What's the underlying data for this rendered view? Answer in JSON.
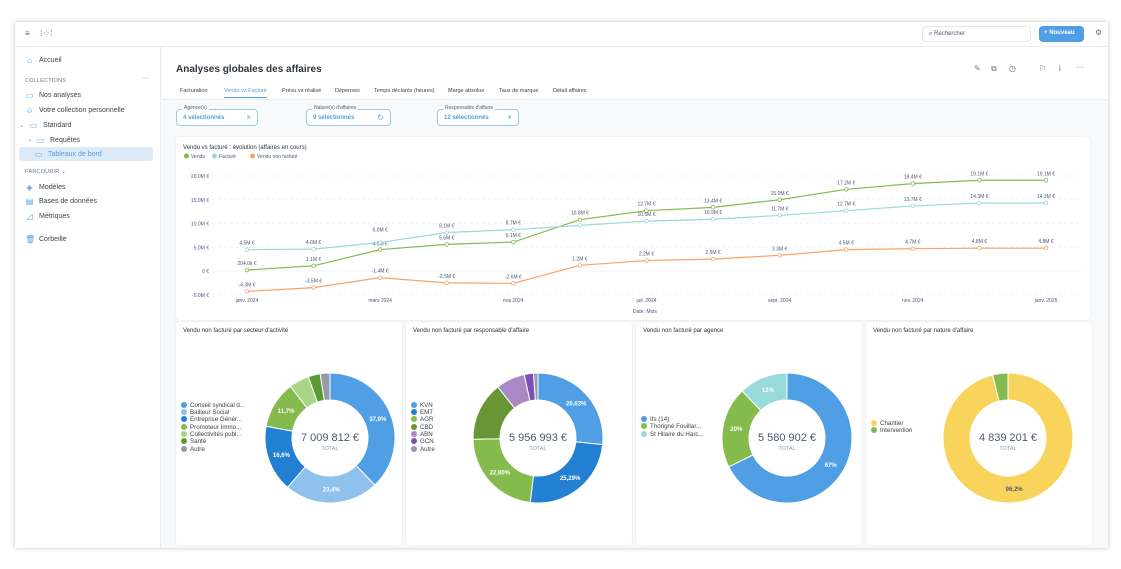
{
  "topbar": {
    "search_placeholder": "Rechercher",
    "new_button": "Nouveau"
  },
  "sidebar": {
    "home": "Accueil",
    "collections_header": "COLLECTIONS",
    "items": [
      "Nos analyses",
      "Votre collection personnelle",
      "Standard",
      "Requêtes",
      "Tableaux de bord"
    ],
    "browse_header": "PARCOURIR",
    "browse": [
      "Modèles",
      "Bases de données",
      "Métriques"
    ],
    "trash": "Corbeille"
  },
  "page": {
    "title": "Analyses globales des affaires"
  },
  "tabs": [
    {
      "label": "Facturation"
    },
    {
      "label": "Vendu vs Facturé",
      "active": true
    },
    {
      "label": "Prévu vs réalisé"
    },
    {
      "label": "Dépenses"
    },
    {
      "label": "Temps déclarés (heures)"
    },
    {
      "label": "Marge absolue"
    },
    {
      "label": "Taux de marque"
    },
    {
      "label": "Détail affaires"
    }
  ],
  "filters": [
    {
      "label": "Agence(s)",
      "value": "4 sélectionnés",
      "icon": "close-icon"
    },
    {
      "label": "Nature(s) d'affaires",
      "value": "9 sélectionnés",
      "icon": "reset-icon"
    },
    {
      "label": "Responsable d'affaire",
      "value": "12 sélectionnés",
      "icon": "close-icon"
    }
  ],
  "chart_data": [
    {
      "type": "line",
      "title": "Vendu vs facturé : évolution (affaires en cours)",
      "xlabel": "Date: Mois",
      "ylim": [
        -5,
        20
      ],
      "y_unit": "M €",
      "yticks": [
        "-5.0M €",
        "0 €",
        "5.0M €",
        "10.0M €",
        "15.0M €",
        "20.0M €"
      ],
      "x": [
        "janv. 2024",
        "févr. 2024",
        "mars 2024",
        "avr. 2024",
        "mai 2024",
        "juin 2024",
        "juil. 2024",
        "août 2024",
        "sept. 2024",
        "oct. 2024",
        "nov. 2024",
        "déc. 2024",
        "janv. 2025"
      ],
      "xtick_labels": [
        "janv. 2024",
        "",
        "mars 2024",
        "",
        "mai 2024",
        "",
        "juil. 2024",
        "",
        "sept. 2024",
        "",
        "nov. 2024",
        "",
        "janv. 2025"
      ],
      "grid": true,
      "legend": "top-left",
      "series": [
        {
          "name": "Vendu",
          "color": "#84bb4c",
          "values": [
            0.204,
            1.1,
            4.5,
            5.6,
            6.1,
            10.8,
            12.7,
            13.4,
            15.0,
            17.2,
            18.4,
            19.1,
            19.1
          ],
          "labels": [
            "204.0k €",
            "1.1M €",
            "4.5M €",
            "5.6M €",
            "6.1M €",
            "10.8M €",
            "12.7M €",
            "13.4M €",
            "15.0M €",
            "17.2M €",
            "18.4M €",
            "19.1M €",
            "19.1M €"
          ]
        },
        {
          "name": "Facturé",
          "color": "#98d9d9",
          "values": [
            4.5,
            4.6,
            6.0,
            8.1,
            8.7,
            9.6,
            10.5,
            10.9,
            11.7,
            12.7,
            13.7,
            14.3,
            14.3
          ],
          "labels": [
            "4.5M €",
            "4.6M €",
            "6.0M €",
            "8.1M €",
            "8.7M €",
            "",
            "10.5M €",
            "10.9M €",
            "11.7M €",
            "12.7M €",
            "13.7M €",
            "14.3M €",
            "14.3M €"
          ]
        },
        {
          "name": "Vendu non facturé",
          "color": "#f9a266",
          "values": [
            -4.3,
            -3.5,
            -1.4,
            -2.5,
            -2.6,
            1.2,
            2.2,
            2.5,
            3.3,
            4.5,
            4.7,
            4.8,
            4.8
          ],
          "labels": [
            "-4.3M €",
            "-3.5M €",
            "-1.4M €",
            "-2.5M €",
            "-2.6M €",
            "1.2M €",
            "2.2M €",
            "2.5M €",
            "3.3M €",
            "4.5M €",
            "4.7M €",
            "4.8M €",
            "4.8M €"
          ]
        }
      ]
    },
    {
      "type": "pie",
      "title": "Vendu non facturé par secteur d'activité",
      "total": "7 009 812 €",
      "total_label": "TOTAL",
      "slices": [
        {
          "name": "Conseil syndical d...",
          "value": 37.9,
          "label": "37,9%",
          "color": "#509ee3"
        },
        {
          "name": "Bailleur Social",
          "value": 23.4,
          "label": "23,4%",
          "color": "#8fc1ee"
        },
        {
          "name": "Entreprise Génér...",
          "value": 16.6,
          "label": "16,6%",
          "color": "#227fd2"
        },
        {
          "name": "Promoteur Immo...",
          "value": 11.7,
          "label": "11,7%",
          "color": "#84bb4c"
        },
        {
          "name": "Collectivités publ...",
          "value": 5.0,
          "label": "",
          "color": "#a8d686"
        },
        {
          "name": "Santé",
          "value": 3.0,
          "label": "",
          "color": "#5e9a34"
        },
        {
          "name": "Autre",
          "value": 2.4,
          "label": "",
          "color": "#949aab"
        }
      ]
    },
    {
      "type": "pie",
      "title": "Vendu non facturé par responsable d'affaire",
      "total": "5 956 993 €",
      "total_label": "TOTAL",
      "slices": [
        {
          "name": "KVN",
          "value": 26.63,
          "label": "26,63%",
          "color": "#509ee3"
        },
        {
          "name": "EMT",
          "value": 25.29,
          "label": "25,29%",
          "color": "#227fd2"
        },
        {
          "name": "AGR",
          "value": 22.8,
          "label": "22,80%",
          "color": "#84bb4c"
        },
        {
          "name": "CBD",
          "value": 14.7,
          "label": "",
          "color": "#689636"
        },
        {
          "name": "ABN",
          "value": 7.2,
          "label": "",
          "color": "#a989c5"
        },
        {
          "name": "GCN",
          "value": 2.3,
          "label": "",
          "color": "#7c4fb4"
        },
        {
          "name": "Autre",
          "value": 1.1,
          "label": "",
          "color": "#949aab"
        }
      ]
    },
    {
      "type": "pie",
      "title": "Vendu non facturé par agence",
      "total": "5 580 902 €",
      "total_label": "TOTAL",
      "slices": [
        {
          "name": "Ifs (14)",
          "value": 67,
          "label": "67%",
          "color": "#509ee3"
        },
        {
          "name": "Thorigné Fouillar...",
          "value": 20,
          "label": "20%",
          "color": "#84bb4c"
        },
        {
          "name": "St Hilaire du Harc...",
          "value": 12,
          "label": "12%",
          "color": "#98d9d9"
        }
      ]
    },
    {
      "type": "pie",
      "title": "Vendu non facturé par nature d'affaire",
      "total": "4 839 201 €",
      "total_label": "TOTAL",
      "slices": [
        {
          "name": "Chantier",
          "value": 96.2,
          "label": "96,2%",
          "color": "#f9d45c"
        },
        {
          "name": "Intervention",
          "value": 3.8,
          "label": "",
          "color": "#84bb4c"
        }
      ]
    }
  ]
}
